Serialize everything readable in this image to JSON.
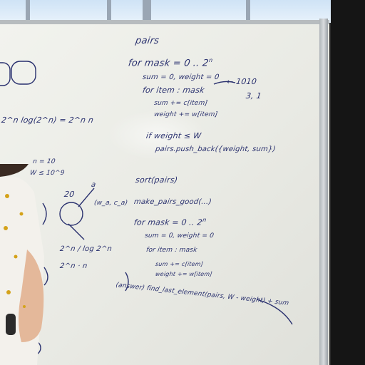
{
  "board_text": {
    "pairs": "pairs",
    "loop_mask": "for mask = 0 .. 2",
    "loop_mask_exp": "n",
    "sum_init": "sum = 0, weight = 0",
    "for_item": "for item : mask",
    "arrow_note": "← 1010",
    "arrow_note2": "3, 1",
    "sum_update": "sum += c[item]",
    "weight_update": "weight += w[item]",
    "if_line": "if weight ≤ W",
    "push_line": "pairs.push_back({weight, sum})",
    "sort_line": "sort(pairs)",
    "make_good": "make_pairs_good(...)",
    "loop_mask2": "for mask = 0 .. 2",
    "loop_mask2_exp": "n",
    "sum_init2": "sum = 0, weight = 0",
    "for_item2": "for item : mask",
    "sum_update2": "sum += c[item]",
    "weight_update2": "weight += w[item]",
    "answer_line": "(answer) find_last_element(pairs, W - weight) + sum",
    "left_formula": "2^n log(2^n) = 2^n n",
    "left_note_a": "n = 10",
    "left_note_b": "W ≤ 10^9",
    "left_twenty": "20",
    "left_a": "a",
    "left_pair": "(w_a, c_a)",
    "left_log": "2^n / log 2^n",
    "left_2n": "2^n · n"
  },
  "colors": {
    "marker": "#29306e",
    "board": "#eeefea",
    "wall": "#151515",
    "window": "#d8e8f6",
    "shirt": "#f3f1ec"
  }
}
